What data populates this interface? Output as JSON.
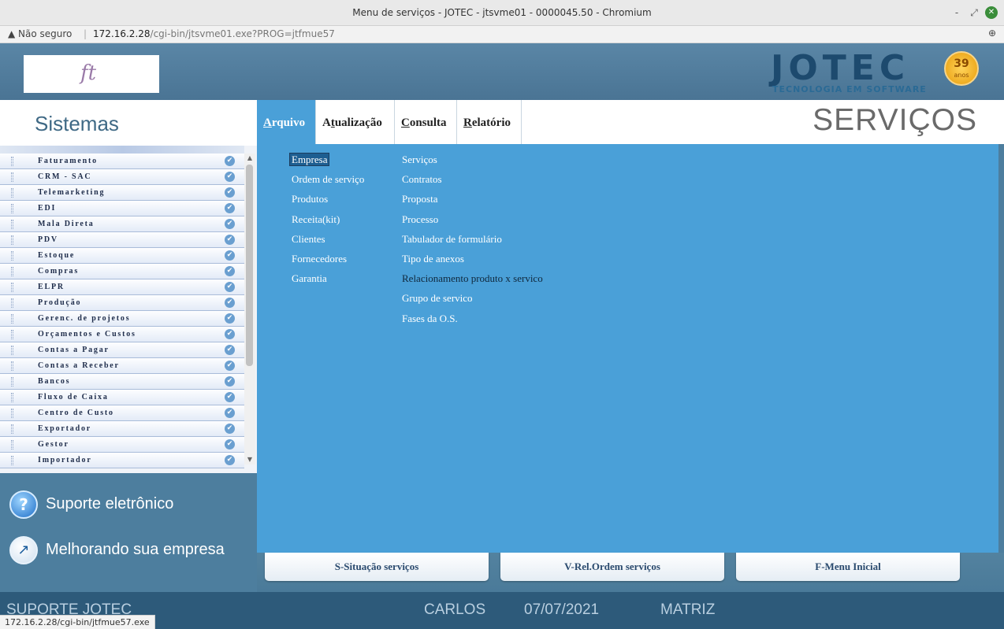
{
  "window": {
    "title": "Menu de serviços - JOTEC - jtsvme01 - 0000045.50 - Chromium",
    "controls": [
      "-",
      "⤢",
      "✕"
    ]
  },
  "address": {
    "warning": "▲ Não seguro",
    "sep": "|",
    "host": "172.16.2.28",
    "path": "/cgi-bin/jtsvme01.exe?PROG=jtfmue57",
    "zoom": "⊕"
  },
  "banner": {
    "logo_text": "ft",
    "brand": "JOTEC",
    "tagline": "TECNOLOGIA EM SOFTWARE",
    "badge_num": "39",
    "badge_label": "anos"
  },
  "sidebar": {
    "title": "Sistemas",
    "items": [
      {
        "label": "Faturamento"
      },
      {
        "label": "CRM - SAC"
      },
      {
        "label": "Telemarketing"
      },
      {
        "label": "EDI"
      },
      {
        "label": "Mala Direta"
      },
      {
        "label": "PDV"
      },
      {
        "label": "Estoque"
      },
      {
        "label": "Compras"
      },
      {
        "label": "ELPR"
      },
      {
        "label": "Produção"
      },
      {
        "label": "Gerenc. de projetos"
      },
      {
        "label": "Orçamentos e Custos"
      },
      {
        "label": "Contas a Pagar"
      },
      {
        "label": "Contas a Receber"
      },
      {
        "label": "Bancos"
      },
      {
        "label": "Fluxo de Caixa"
      },
      {
        "label": "Centro de Custo"
      },
      {
        "label": "Exportador"
      },
      {
        "label": "Gestor"
      },
      {
        "label": "Importador"
      }
    ],
    "check_glyph": "✔",
    "links": {
      "support": "Suporte eletrônico",
      "improve": "Melhorando sua empresa",
      "support_glyph": "?",
      "improve_glyph": "↗"
    }
  },
  "menu": {
    "tabs": [
      {
        "pre": "",
        "ul": "A",
        "post": "rquivo"
      },
      {
        "pre": "A",
        "ul": "t",
        "post": "ualização"
      },
      {
        "pre": "",
        "ul": "C",
        "post": "onsulta"
      },
      {
        "pre": "",
        "ul": "R",
        "post": "elatório"
      }
    ],
    "module_title": "SERVIÇOS"
  },
  "submenu": {
    "col1": [
      "Empresa",
      "Ordem de serviço",
      "Produtos",
      "Receita(kit)",
      "Clientes",
      "Fornecedores",
      "Garantia"
    ],
    "col2": [
      "Serviços",
      "Contratos",
      "Proposta",
      "Processo",
      "Tabulador de formulário",
      "Tipo de anexos",
      "Relacionamento produto x servico",
      "Grupo de servico",
      "Fases da O.S."
    ]
  },
  "buttons": {
    "situacao": "S-Situação serviços",
    "rel_ordem": "V-Rel.Ordem serviços",
    "menu_inicial": "F-Menu Inicial"
  },
  "footer": {
    "left": "SUPORTE JOTEC",
    "user": "CARLOS",
    "date": "07/07/2021",
    "branch": "MATRIZ"
  },
  "status_url": "172.16.2.28/cgi-bin/jtfmue57.exe",
  "scroll": {
    "up": "▲",
    "down": "▼"
  }
}
